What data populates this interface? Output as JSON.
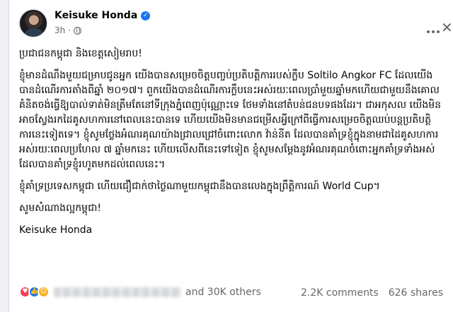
{
  "post": {
    "author": "Keisuke Honda",
    "time": "3h",
    "paragraphs": [
      "ប្រជាជនកម្ពុជា និងខេត្តសៀមរាប!",
      "ខ្ញុំមានដំណឹងមួយជម្រាបជូនអ្នក យើងបានសម្រេចចិត្តបញ្ចប់ប្រតិបត្តិការរបស់ក្លឹប Soltilo Angkor FC ដែលយើងបានដំណើរការតាំងពីឆ្នាំ ២០១៧។ ពួកយើងបានដំណើរការក្លឹបនេះអស់រយៈពេលប្រាំមួយឆ្នាំមកហើយជាមួយនឹងគោលគំនិតចង់ធ្វើឱ្យបាល់ទាត់មិនត្រឹមតែនៅទីក្រុងភ្នំពេញប៉ុណ្ណោះទេ ថែមទាំងនៅតំបន់ជនបទផងដែរ។ ជាអកុសល យើងមិនអាចស្វែងរកដៃគូសហការនៅពេលនេះបានទេ ហើយយើងមិនមានជម្រើសអ្វីក្រៅពីធ្វើការសម្រេចចិត្តឈប់បន្តប្រតិបត្តិការនេះទៀតទេ។ ខ្ញុំសូមថ្លែងអំណរគុណយ៉ាងជ្រាលជ្រៅចំពោះលោក វ៉ាន់នីត ដែលបានគាំទ្រខ្ញុំក្នុងនាមជាដៃគូសហការអស់រយៈពេលប្រហែល ៧ ឆ្នាំមកនេះ ហើយលើសពីនេះទៅទៀត ខ្ញុំសូមសម្តែងនូវអំណរគុណចំពោះអ្នកគាំទ្រទាំងអស់ដែលបានគាំទ្រខ្ញុំរហូតមកដល់ពេលនេះ។",
      "ខ្ញុំគាំទ្រប្រទេសកម្ពុជា ហើយជឿជាក់ថាថ្ងៃណាមួយកម្ពុជានឹងបានលេងក្នុងព្រឹត្តិការណ៍ World Cup។",
      "សូមសំណាងល្អកម្ពុជា!",
      "Keisuke Honda"
    ]
  },
  "engagement": {
    "and_others": "and 30K others",
    "comments": "2.2K comments",
    "shares": "626 shares"
  },
  "icons": {
    "verified": "verified-badge-icon",
    "globe": "globe-icon",
    "more": "more-options-icon",
    "close": "close-icon",
    "reactions": [
      "love-reaction-icon",
      "like-reaction-icon",
      "care-reaction-icon"
    ]
  },
  "colors": {
    "accent": "#1877f2",
    "love": "#f33e58",
    "care": "#f7b125",
    "muted_text": "#65676b"
  }
}
